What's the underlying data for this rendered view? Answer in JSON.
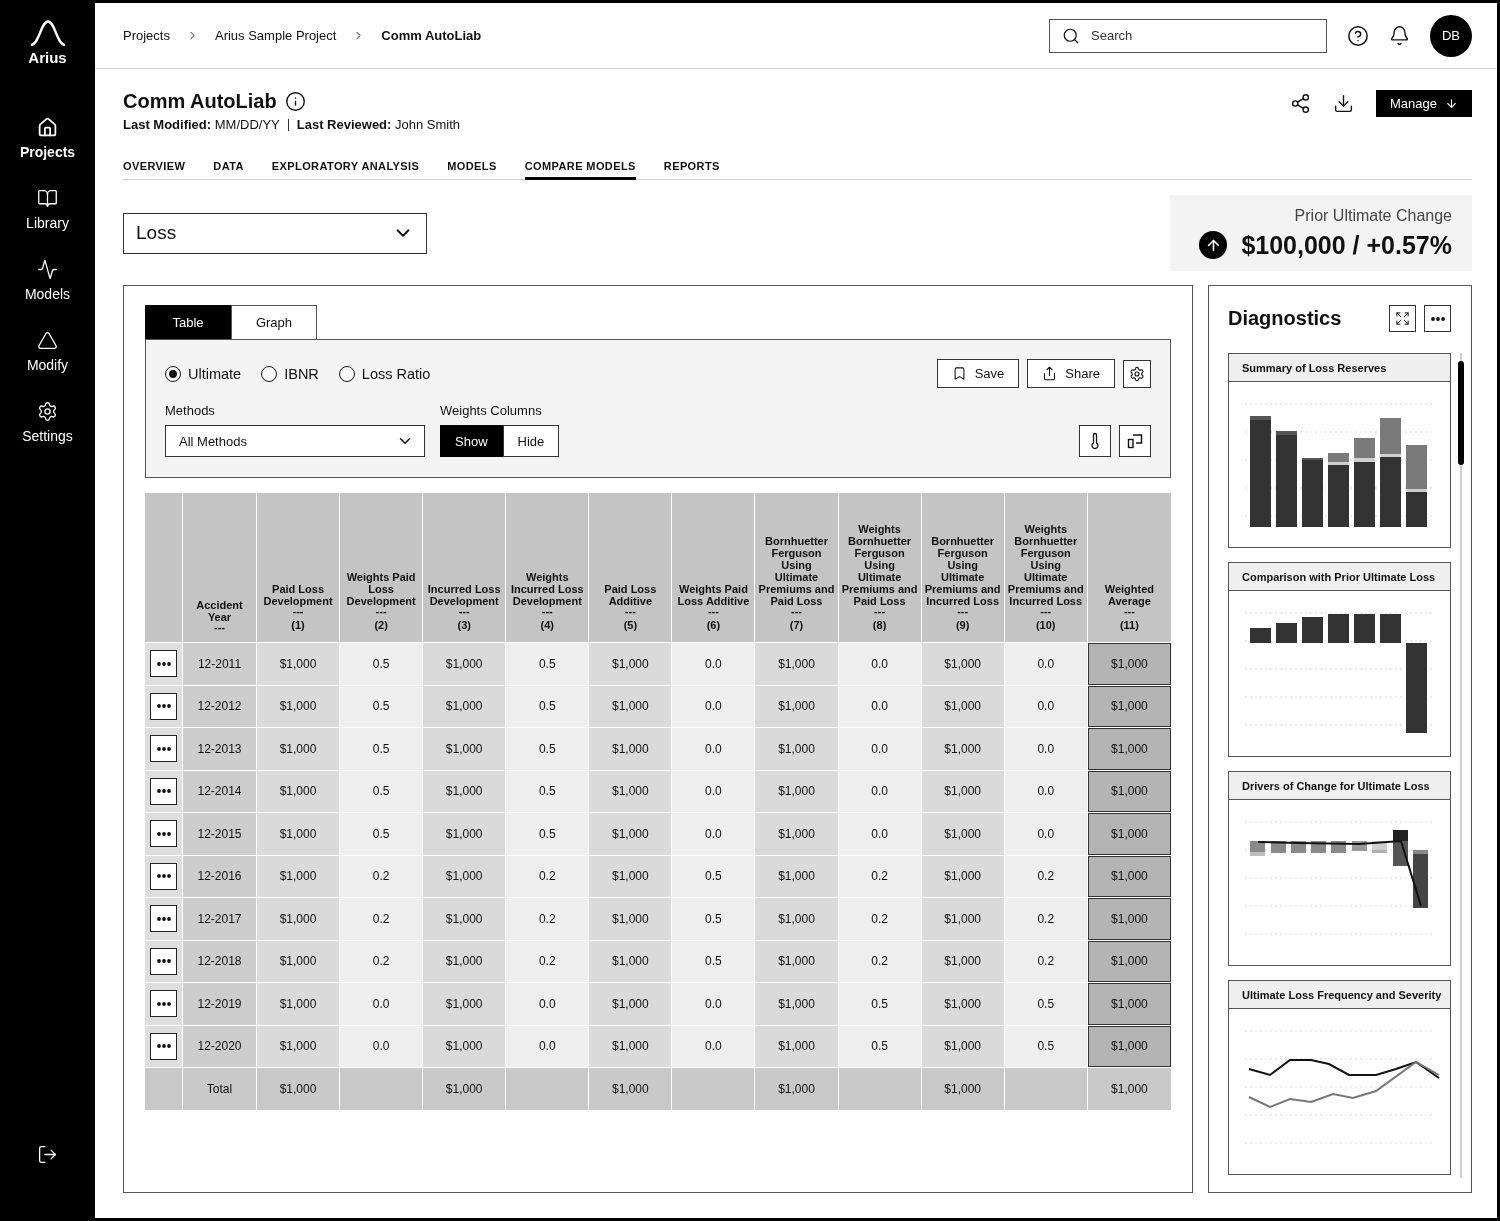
{
  "sidebar": {
    "logo": "Arius",
    "items": [
      {
        "label": "Projects",
        "selected": true
      },
      {
        "label": "Library",
        "selected": false
      },
      {
        "label": "Models",
        "selected": false
      },
      {
        "label": "Modify",
        "selected": false
      },
      {
        "label": "Settings",
        "selected": false
      }
    ]
  },
  "topbar": {
    "breadcrumbs": [
      {
        "label": "Projects",
        "current": false
      },
      {
        "label": "Arius Sample Project",
        "current": false
      },
      {
        "label": "Comm AutoLiab",
        "current": true
      }
    ],
    "search": {
      "placeholder": "Search"
    },
    "avatar": "DB"
  },
  "header": {
    "title": "Comm AutoLiab",
    "meta": [
      "**Last Modified:** MM/DD/YY",
      "**Last Reviewed:** John Smith"
    ],
    "manage_button": "Manage"
  },
  "tabs": [
    {
      "label": "OVERVIEW",
      "selected": false
    },
    {
      "label": "DATA",
      "selected": false
    },
    {
      "label": "EXPLORATORY ANALYSIS",
      "selected": false
    },
    {
      "label": "MODELS",
      "selected": false
    },
    {
      "label": "COMPARE MODELS",
      "selected": true
    },
    {
      "label": "REPORTS",
      "selected": false
    }
  ],
  "measure_select": {
    "value": "Loss"
  },
  "prior_change": {
    "label": "Prior Ultimate Change",
    "value": "$100,000 / +0.57%",
    "increase": true
  },
  "view_tabs": [
    {
      "label": "Table",
      "selected": true
    },
    {
      "label": "Graph",
      "selected": false
    }
  ],
  "controls": {
    "radio_options": [
      {
        "label": "Ultimate",
        "selected": true
      },
      {
        "label": "IBNR",
        "selected": false
      },
      {
        "label": "Loss Ratio",
        "selected": false
      }
    ],
    "actions": [
      {
        "label": "Save"
      },
      {
        "label": "Share"
      }
    ],
    "methods": {
      "label": "Methods",
      "value": "All Methods"
    },
    "weights_columns": {
      "label": "Weights Columns",
      "options": [
        {
          "label": "Show",
          "selected": true
        },
        {
          "label": "Hide",
          "selected": false
        }
      ]
    }
  },
  "table": {
    "columns": [
      {
        "title": "Accident Year",
        "divider": "---",
        "kind": "year"
      },
      {
        "title": "Paid Loss Development",
        "divider": "---",
        "number": "(1)",
        "kind": "value"
      },
      {
        "title": "Weights Paid Loss Development",
        "divider": "---",
        "number": "(2)",
        "kind": "weight"
      },
      {
        "title": "Incurred Loss Development",
        "divider": "---",
        "number": "(3)",
        "kind": "value"
      },
      {
        "title": "Weights Incurred Loss Development",
        "divider": "---",
        "number": "(4)",
        "kind": "weight"
      },
      {
        "title": "Paid Loss Additive",
        "divider": "---",
        "number": "(5)",
        "kind": "value"
      },
      {
        "title": "Weights Paid Loss Additive",
        "divider": "---",
        "number": "(6)",
        "kind": "weight"
      },
      {
        "title": "Bornhuetter Ferguson Using Ultimate Premiums and Paid Loss",
        "divider": "---",
        "number": "(7)",
        "kind": "value"
      },
      {
        "title": "Weights Bornhuetter Ferguson Using Ultimate Premiums and Paid Loss",
        "divider": "---",
        "number": "(8)",
        "kind": "weight"
      },
      {
        "title": "Bornhuetter Ferguson Using Ultimate Premiums and Incurred Loss",
        "divider": "---",
        "number": "(9)",
        "kind": "value"
      },
      {
        "title": "Weights Bornhuetter Ferguson Using Ultimate Premiums and Incurred Loss",
        "divider": "---",
        "number": "(10)",
        "kind": "weight"
      },
      {
        "title": "Weighted Average",
        "divider": "---",
        "number": "(11)",
        "kind": "average"
      }
    ],
    "rows": [
      {
        "year": "12-2011",
        "values": [
          "$1,000",
          "0.5",
          "$1,000",
          "0.5",
          "$1,000",
          "0.0",
          "$1,000",
          "0.0",
          "$1,000",
          "0.0",
          "$1,000"
        ]
      },
      {
        "year": "12-2012",
        "values": [
          "$1,000",
          "0.5",
          "$1,000",
          "0.5",
          "$1,000",
          "0.0",
          "$1,000",
          "0.0",
          "$1,000",
          "0.0",
          "$1,000"
        ]
      },
      {
        "year": "12-2013",
        "values": [
          "$1,000",
          "0.5",
          "$1,000",
          "0.5",
          "$1,000",
          "0.0",
          "$1,000",
          "0.0",
          "$1,000",
          "0.0",
          "$1,000"
        ]
      },
      {
        "year": "12-2014",
        "values": [
          "$1,000",
          "0.5",
          "$1,000",
          "0.5",
          "$1,000",
          "0.0",
          "$1,000",
          "0.0",
          "$1,000",
          "0.0",
          "$1,000"
        ]
      },
      {
        "year": "12-2015",
        "values": [
          "$1,000",
          "0.5",
          "$1,000",
          "0.5",
          "$1,000",
          "0.0",
          "$1,000",
          "0.0",
          "$1,000",
          "0.0",
          "$1,000"
        ]
      },
      {
        "year": "12-2016",
        "values": [
          "$1,000",
          "0.2",
          "$1,000",
          "0.2",
          "$1,000",
          "0.5",
          "$1,000",
          "0.2",
          "$1,000",
          "0.2",
          "$1,000"
        ]
      },
      {
        "year": "12-2017",
        "values": [
          "$1,000",
          "0.2",
          "$1,000",
          "0.2",
          "$1,000",
          "0.5",
          "$1,000",
          "0.2",
          "$1,000",
          "0.2",
          "$1,000"
        ]
      },
      {
        "year": "12-2018",
        "values": [
          "$1,000",
          "0.2",
          "$1,000",
          "0.2",
          "$1,000",
          "0.5",
          "$1,000",
          "0.2",
          "$1,000",
          "0.2",
          "$1,000"
        ]
      },
      {
        "year": "12-2019",
        "values": [
          "$1,000",
          "0.0",
          "$1,000",
          "0.0",
          "$1,000",
          "0.0",
          "$1,000",
          "0.5",
          "$1,000",
          "0.5",
          "$1,000"
        ]
      },
      {
        "year": "12-2020",
        "values": [
          "$1,000",
          "0.0",
          "$1,000",
          "0.0",
          "$1,000",
          "0.0",
          "$1,000",
          "0.5",
          "$1,000",
          "0.5",
          "$1,000"
        ]
      }
    ],
    "total": {
      "label": "Total",
      "values": [
        "$1,000",
        "$1,000",
        "$1,000",
        "$1,000",
        "$1,000",
        "$1,000"
      ]
    }
  },
  "diagnostics": {
    "title": "Diagnostics",
    "charts": [
      {
        "title": "Summary of Loss Reserves",
        "kind": "stacked_bar"
      },
      {
        "title": "Comparison with Prior Ultimate Loss",
        "kind": "waterfall"
      },
      {
        "title": "Drivers of Change for Ultimate Loss",
        "kind": "drivers"
      },
      {
        "title": "Ultimate Loss Frequency and Severity",
        "kind": "lines"
      }
    ]
  }
}
